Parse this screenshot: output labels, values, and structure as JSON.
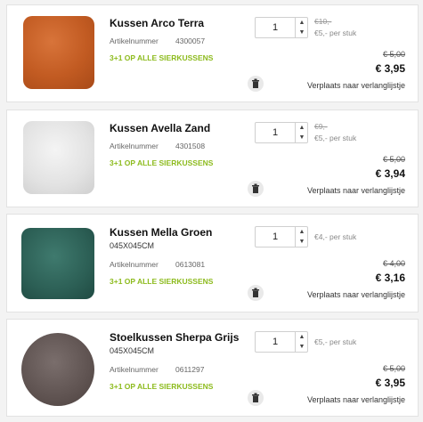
{
  "items": [
    {
      "name": "Kussen Arco Terra",
      "article_label": "Artikelnummer",
      "article_number": "4300057",
      "promo": "3+1 OP ALLE SIERKUSSENS",
      "quantity": "1",
      "unit_old": "€10,-",
      "unit_price": "€5,- per stuk",
      "price_old": "€ 5,00",
      "price": "€ 3,95",
      "wishlist": "Verplaats naar verlanglijstje",
      "image": "orange-pillow"
    },
    {
      "name": "Kussen Avella Zand",
      "article_label": "Artikelnummer",
      "article_number": "4301508",
      "promo": "3+1 OP ALLE SIERKUSSENS",
      "quantity": "1",
      "unit_old": "€9,-",
      "unit_price": "€5,- per stuk",
      "price_old": "€ 5,00",
      "price": "€ 3,94",
      "wishlist": "Verplaats naar verlanglijstje",
      "image": "white-pillow"
    },
    {
      "name": "Kussen Mella Groen",
      "size": "045X045CM",
      "article_label": "Artikelnummer",
      "article_number": "0613081",
      "promo": "3+1 OP ALLE SIERKUSSENS",
      "quantity": "1",
      "unit_price": "€4,- per stuk",
      "price_old": "€ 4,00",
      "price": "€ 3,16",
      "wishlist": "Verplaats naar verlanglijstje",
      "image": "green-pillow"
    },
    {
      "name": "Stoelkussen Sherpa Grijs",
      "size": "045X045CM",
      "article_label": "Artikelnummer",
      "article_number": "0611297",
      "promo": "3+1 OP ALLE SIERKUSSENS",
      "quantity": "1",
      "unit_price": "€5,- per stuk",
      "price_old": "€ 5,00",
      "price": "€ 3,95",
      "wishlist": "Verplaats naar verlanglijstje",
      "image": "grey-round-cushion"
    }
  ],
  "icons": {
    "up": "chevron-up-icon",
    "down": "chevron-down-icon",
    "delete": "trash-icon"
  },
  "colors": {
    "promo": "#8dbb1e",
    "background": "#f3f3f3"
  }
}
